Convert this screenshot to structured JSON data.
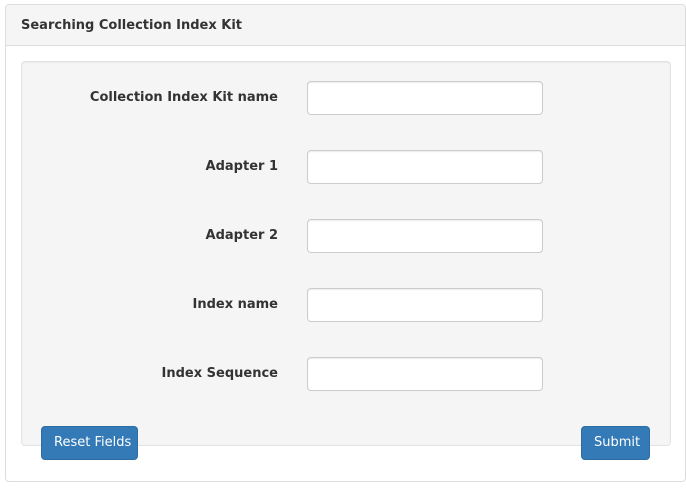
{
  "panel": {
    "title": "Searching Collection Index Kit"
  },
  "form": {
    "fields": [
      {
        "label": "Collection Index Kit name",
        "value": "",
        "placeholder": ""
      },
      {
        "label": "Adapter 1",
        "value": "",
        "placeholder": ""
      },
      {
        "label": "Adapter 2",
        "value": "",
        "placeholder": ""
      },
      {
        "label": "Index name",
        "value": "",
        "placeholder": ""
      },
      {
        "label": "Index Sequence",
        "value": "",
        "placeholder": ""
      }
    ],
    "reset_label": "Reset Fields",
    "submit_label": "Submit"
  },
  "colors": {
    "primary_button": "#337ab7",
    "panel_heading_bg": "#f5f5f5",
    "well_bg": "#f5f5f5"
  }
}
